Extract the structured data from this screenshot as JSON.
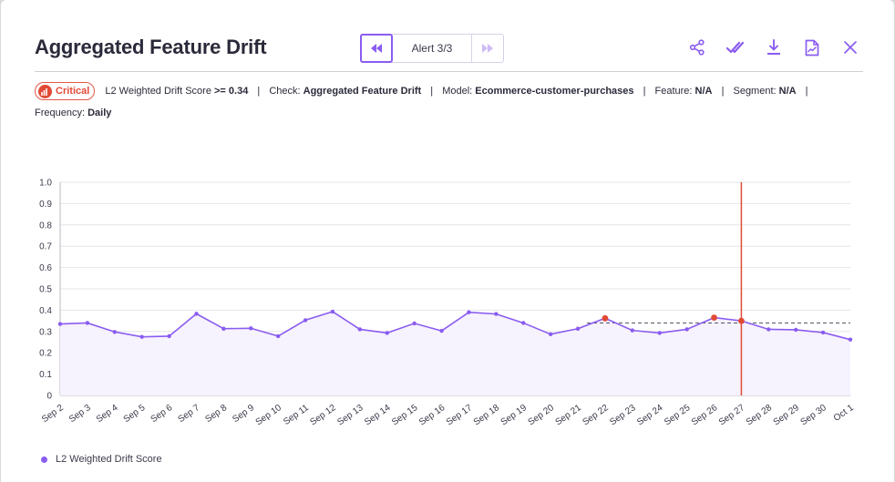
{
  "header": {
    "title": "Aggregated Feature Drift",
    "alert_label": "Alert 3/3"
  },
  "meta": {
    "severity": "Critical",
    "metric_label": "L2 Weighted Drift Score",
    "threshold": ">= 0.34",
    "check_label": "Check:",
    "check_value": "Aggregated Feature Drift",
    "model_label": "Model:",
    "model_value": "Ecommerce-customer-purchases",
    "feature_label": "Feature:",
    "feature_value": "N/A",
    "segment_label": "Segment:",
    "segment_value": "N/A",
    "frequency_label": "Frequency:",
    "frequency_value": "Daily",
    "separator": "|"
  },
  "icons": {
    "prev": "rewind-icon",
    "next": "fast-forward-icon",
    "share": "share-icon",
    "resolve": "double-check-icon",
    "download": "download-icon",
    "report": "report-icon",
    "close": "close-icon"
  },
  "colors": {
    "accent": "#8a5cf0",
    "critical": "#e14a35",
    "fill": "#f6f2fe"
  },
  "chart_data": {
    "type": "line",
    "x": [
      "Sep 2",
      "Sep 3",
      "Sep 4",
      "Sep 5",
      "Sep 6",
      "Sep 7",
      "Sep 8",
      "Sep 9",
      "Sep 10",
      "Sep 11",
      "Sep 12",
      "Sep 13",
      "Sep 14",
      "Sep 15",
      "Sep 16",
      "Sep 17",
      "Sep 18",
      "Sep 19",
      "Sep 20",
      "Sep 21",
      "Sep 22",
      "Sep 23",
      "Sep 24",
      "Sep 25",
      "Sep 26",
      "Sep 27",
      "Sep 28",
      "Sep 29",
      "Sep 30",
      "Oct 1"
    ],
    "series": [
      {
        "name": "L2 Weighted Drift Score",
        "values": [
          0.335,
          0.34,
          0.298,
          0.275,
          0.278,
          0.383,
          0.313,
          0.315,
          0.278,
          0.353,
          0.393,
          0.31,
          0.293,
          0.338,
          0.303,
          0.39,
          0.382,
          0.34,
          0.287,
          0.313,
          0.362,
          0.305,
          0.293,
          0.31,
          0.365,
          0.35,
          0.31,
          0.308,
          0.295,
          0.262
        ]
      }
    ],
    "alerts": [
      "Sep 22",
      "Sep 26",
      "Sep 27"
    ],
    "threshold": 0.34,
    "threshold_start": "Sep 21",
    "marker": "Sep 27",
    "yticks": [
      "0",
      "0.1",
      "0.2",
      "0.3",
      "0.4",
      "0.5",
      "0.6",
      "0.7",
      "0.8",
      "0.9",
      "1.0"
    ],
    "ylim": [
      0,
      1.0
    ],
    "grid": true,
    "legend_position": "bottom-left"
  }
}
